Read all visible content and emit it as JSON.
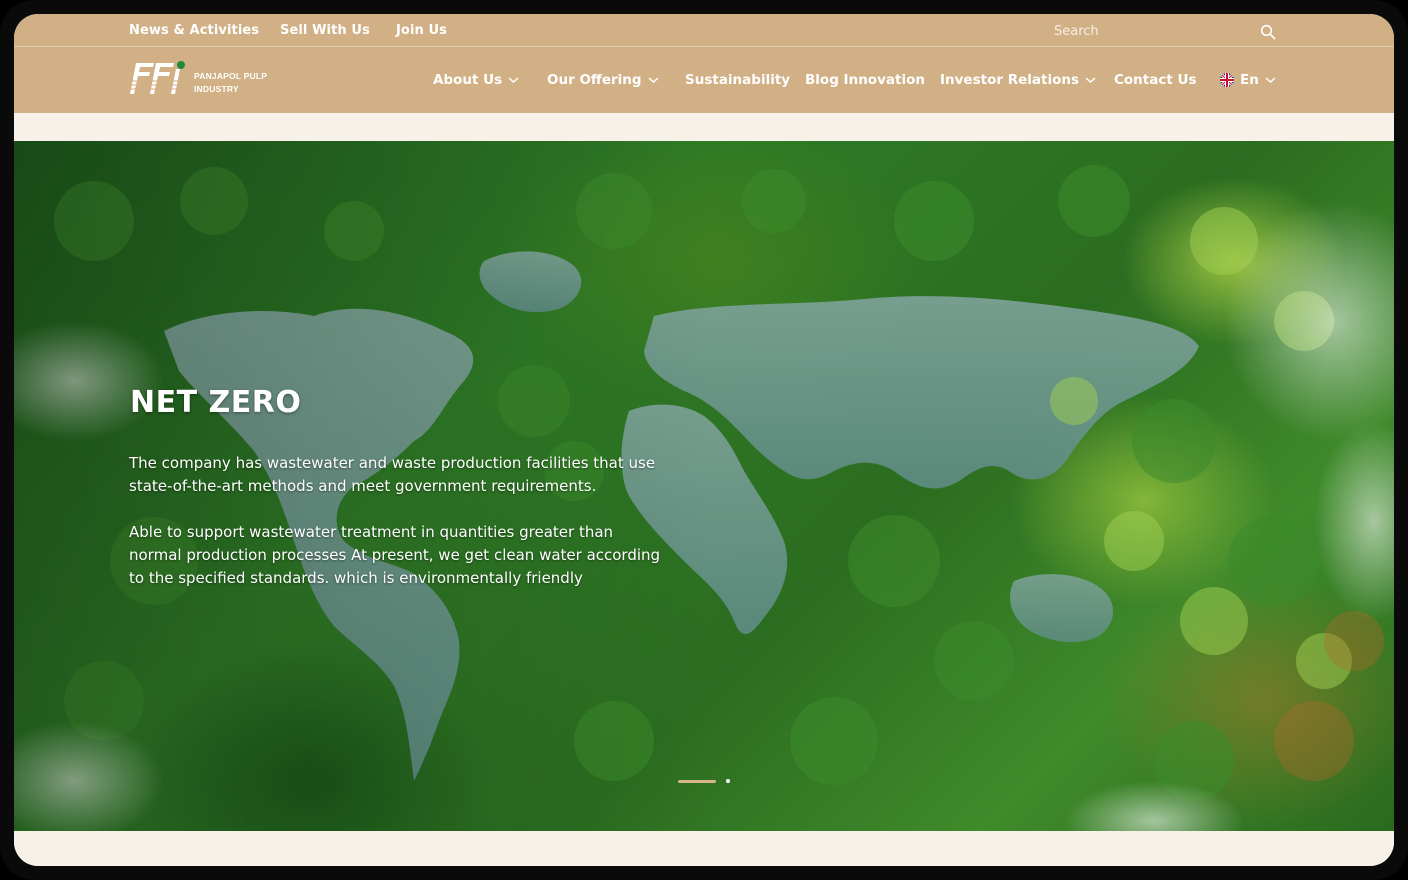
{
  "topbar": {
    "links": [
      "News & Activities",
      "Sell With Us",
      "Join Us"
    ],
    "search_placeholder": "Search"
  },
  "logo": {
    "line1": "PANJAPOL PULP",
    "line2": "INDUSTRY",
    "accent_color": "#1f8a3a"
  },
  "nav": {
    "items": [
      {
        "label": "About Us",
        "has_dropdown": true
      },
      {
        "label": "Our Offering",
        "has_dropdown": true
      },
      {
        "label": "Sustainability",
        "has_dropdown": false
      },
      {
        "label": "Blog Innovation",
        "has_dropdown": false
      },
      {
        "label": "Investor Relations",
        "has_dropdown": true
      },
      {
        "label": "Contact Us",
        "has_dropdown": false
      }
    ],
    "language": {
      "label": "En",
      "icon": "uk-flag-icon"
    }
  },
  "hero": {
    "title": "NET ZERO",
    "paragraph1": "The company has wastewater and waste production facilities that use state-of-the-art methods and meet government requirements.",
    "paragraph2": "Able to support wastewater treatment in quantities greater than normal production processes At present, we get clean water according  to the specified standards. which is environmentally friendly",
    "slides_total": 2,
    "slide_active": 1
  },
  "colors": {
    "header_bg": "#d1b085",
    "page_bg": "#f8f1e9",
    "dot_active": "#d7b48b"
  }
}
